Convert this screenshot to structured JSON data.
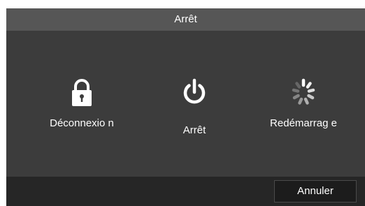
{
  "dialog": {
    "title": "Arrêt",
    "options": [
      {
        "label": "Déconnexio n",
        "icon": "lock-icon"
      },
      {
        "label": "Arrêt",
        "icon": "power-icon"
      },
      {
        "label": "Redémarrag e",
        "icon": "spinner-icon"
      }
    ],
    "cancel_label": "Annuler"
  },
  "colors": {
    "title_bar": "#565656",
    "body": "#3c3c3c",
    "footer": "#262626",
    "text": "#ffffff"
  }
}
